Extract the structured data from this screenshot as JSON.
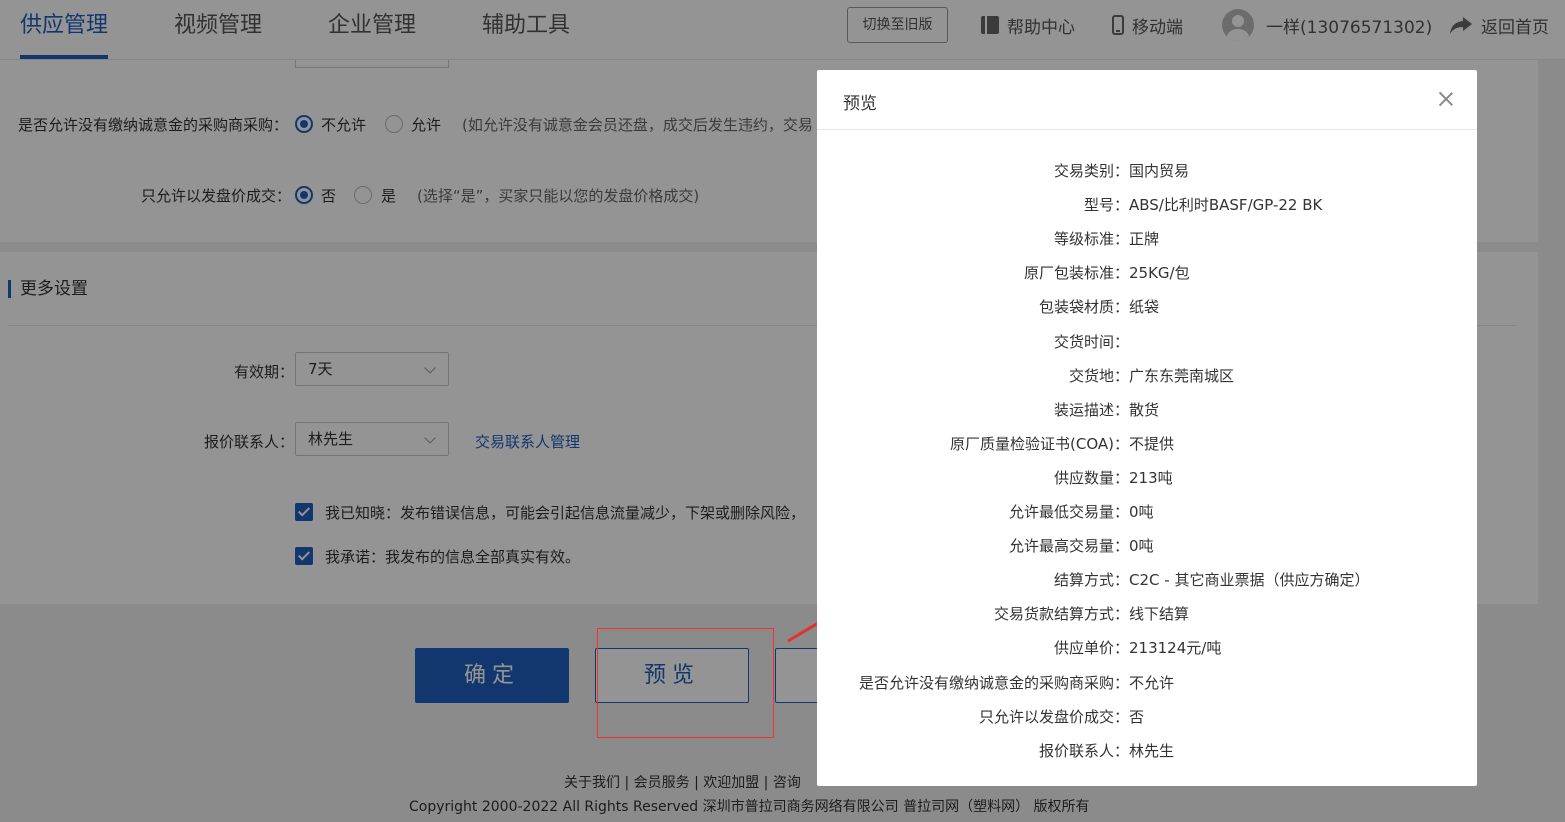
{
  "nav": {
    "tabs": [
      "供应管理",
      "视频管理",
      "企业管理",
      "辅助工具"
    ],
    "old_version_button": "切换至旧版",
    "help": "帮助中心",
    "mobile": "移动端",
    "user": "一样(13076571302)",
    "home": "返回首页"
  },
  "form": {
    "deposit_label": "是否允许没有缴纳诚意金的采购商采购：",
    "deposit_options": [
      "不允许",
      "允许"
    ],
    "deposit_selected": "不允许",
    "deposit_hint": "(如允许没有诚意金会员还盘，成交后发生违约，交易",
    "offer_label": "只允许以发盘价成交：",
    "offer_options": [
      "否",
      "是"
    ],
    "offer_selected": "否",
    "offer_hint": "(选择“是”，买家只能以您的发盘价格成交)",
    "more_settings": "更多设置",
    "validity_label": "有效期：",
    "validity_value": "7天",
    "contact_label": "报价联系人：",
    "contact_value": "林先生",
    "contact_manage_link": "交易联系人管理",
    "agree1": "我已知晓：发布错误信息，可能会引起信息流量减少，下架或删除风险，",
    "agree2": "我承诺：我发布的信息全部真实有效。"
  },
  "buttons": {
    "confirm": "确定",
    "preview": "预览"
  },
  "footer": {
    "links": "关于我们 |  会员服务 |  欢迎加盟 |  咨询",
    "copyright": "Copyright 2000-2022 All Rights Reserved 深圳市普拉司商务网络有限公司 普拉司网（塑料网） 版权所有"
  },
  "modal": {
    "title": "预览",
    "rows": [
      {
        "k": "交易类别：",
        "v": "国内贸易"
      },
      {
        "k": "型号：",
        "v": "ABS/比利时BASF/GP-22 BK"
      },
      {
        "k": "等级标准：",
        "v": "正牌"
      },
      {
        "k": "原厂包装标准：",
        "v": "25KG/包"
      },
      {
        "k": "包装袋材质：",
        "v": "纸袋"
      },
      {
        "k": "交货时间：",
        "v": ""
      },
      {
        "k": "交货地：",
        "v": "广东东莞南城区"
      },
      {
        "k": "装运描述：",
        "v": "散货"
      },
      {
        "k": "原厂质量检验证书(COA)：",
        "v": "不提供"
      },
      {
        "k": "供应数量：",
        "v": "213吨"
      },
      {
        "k": "允许最低交易量：",
        "v": "0吨"
      },
      {
        "k": "允许最高交易量：",
        "v": "0吨"
      },
      {
        "k": "结算方式：",
        "v": "C2C - 其它商业票据（供应方确定）"
      },
      {
        "k": "交易货款结算方式：",
        "v": "线下结算"
      },
      {
        "k": "供应单价：",
        "v": "213124元/吨"
      },
      {
        "k": "是否允许没有缴纳诚意金的采购商采购：",
        "v": "不允许"
      },
      {
        "k": "只允许以发盘价成交：",
        "v": "否"
      },
      {
        "k": "报价联系人：",
        "v": "林先生"
      }
    ]
  }
}
